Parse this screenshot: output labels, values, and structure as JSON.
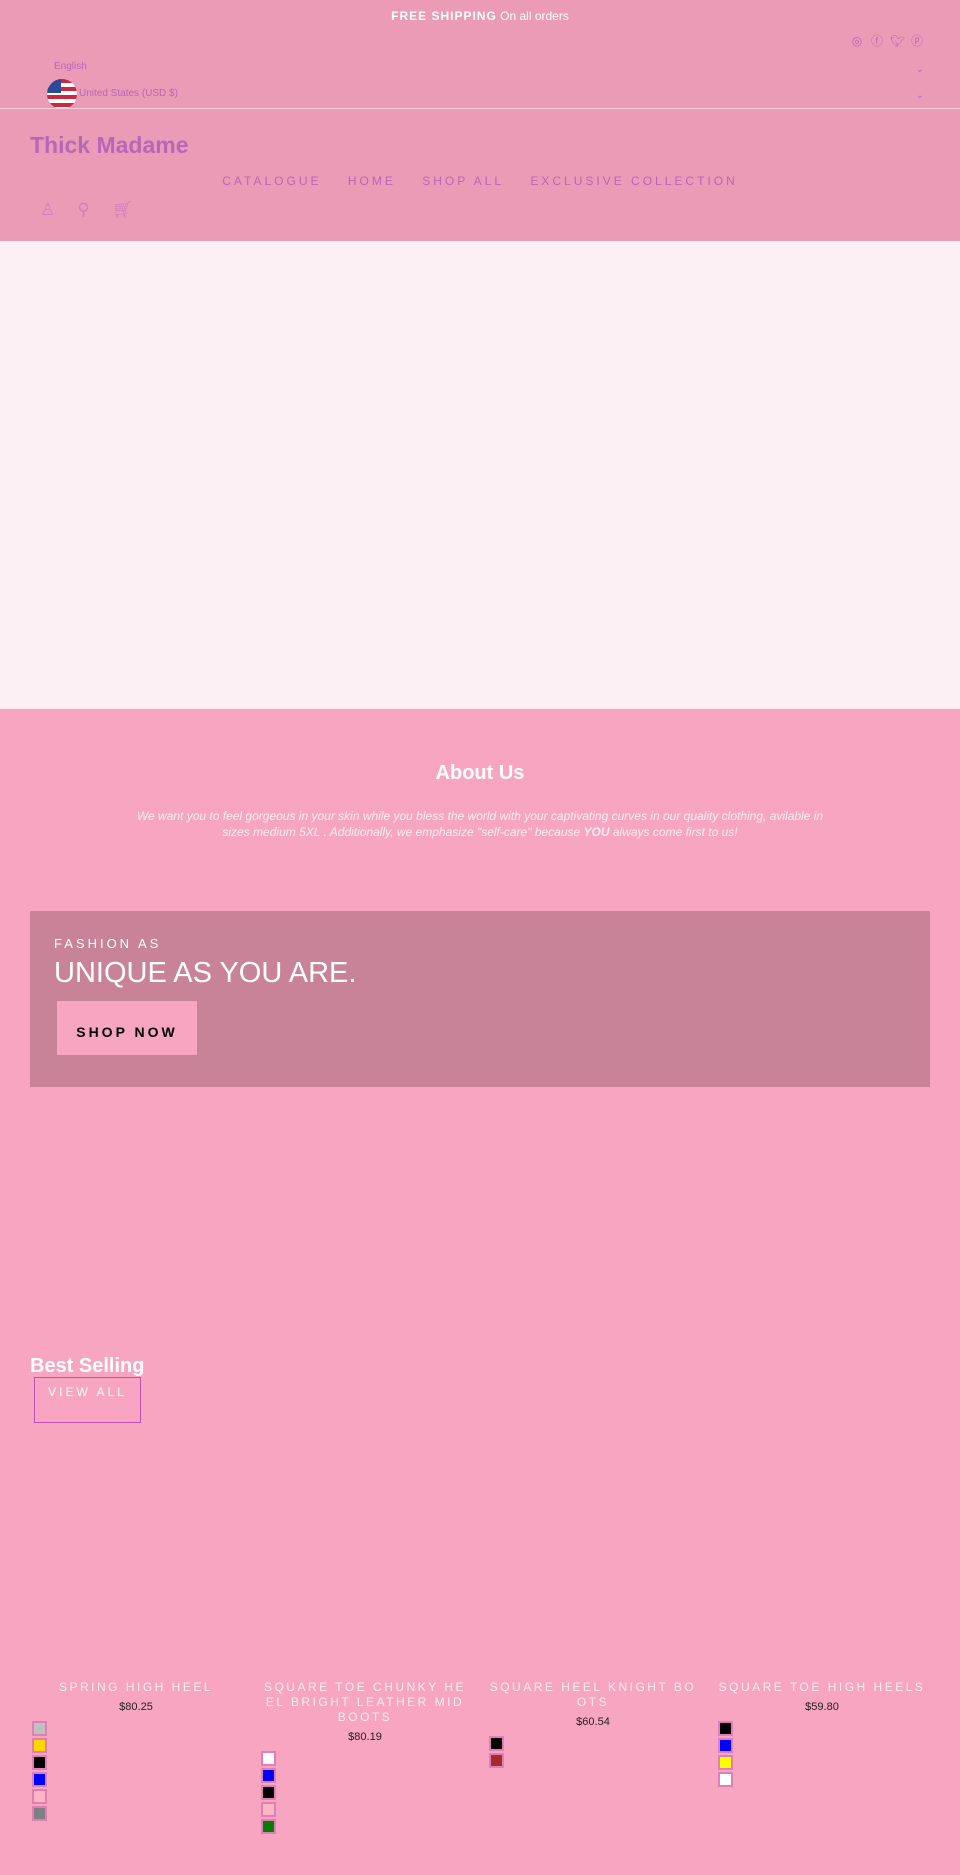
{
  "announcement": {
    "bold": "FREE SHIPPING",
    "text": "On all orders"
  },
  "social": [
    "instagram-icon",
    "facebook-icon",
    "twitter-icon",
    "pinterest-icon"
  ],
  "language": "English",
  "currency": "United States (USD $)",
  "logo": "Thick Madame",
  "nav": [
    "CATALOGUE",
    "HOME",
    "SHOP ALL",
    "EXCLUSIVE COLLECTION"
  ],
  "about": {
    "title": "About Us",
    "text_before": "We want you to feel gorgeous in your skin while you bless the world with your captivating curves in our quality clothing, avilable in sizes medium 5XL . Additionally, we emphasize \"self-care\" because ",
    "bold": "YOU",
    "text_after": " always come first to us!"
  },
  "banner": {
    "subtitle": "FASHION AS",
    "title": "UNIQUE AS YOU ARE.",
    "button": "SHOP NOW"
  },
  "best_selling": {
    "title": "Best Selling",
    "view_all": "VIEW ALL"
  },
  "products": [
    {
      "title": "SPRING HIGH HEEL",
      "price": "$80.25",
      "swatches": [
        "#c0c0c0",
        "#ffd700",
        "#000000",
        "#0000ff",
        "#ffb6c1",
        "#808080"
      ]
    },
    {
      "title": "SQUARE TOE CHUNKY HEEL BRIGHT LEATHER MID BOOTS",
      "price": "$80.19",
      "swatches": [
        "#ffffff",
        "#0000ff",
        "#000000",
        "#ffb6c1",
        "#008000"
      ]
    },
    {
      "title": "SQUARE HEEL KNIGHT BOOTS",
      "price": "$60.54",
      "swatches": [
        "#000000",
        "#a52a2a"
      ]
    },
    {
      "title": "SQUARE TOE HIGH HEELS",
      "price": "$59.80",
      "swatches": [
        "#000000",
        "#0000ff",
        "#ffff00",
        "#ffffff"
      ]
    }
  ]
}
